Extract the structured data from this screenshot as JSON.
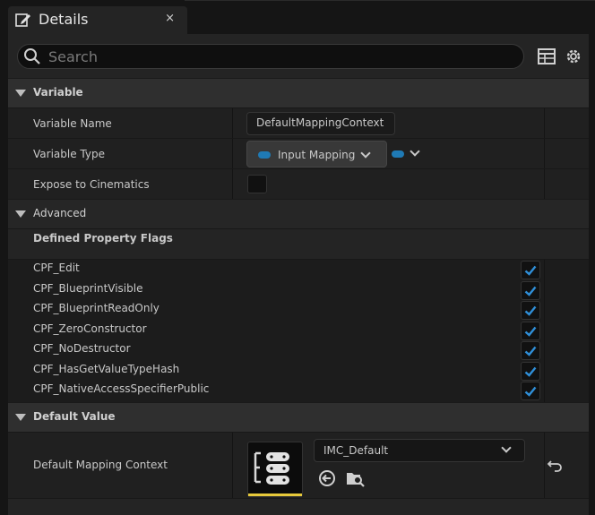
{
  "tab": {
    "title": "Details",
    "close_label": "×",
    "icon": "pencil-icon"
  },
  "search": {
    "placeholder": "Search",
    "value": ""
  },
  "toolbar": {
    "icons": [
      "table-view-icon",
      "gear-icon"
    ]
  },
  "variable": {
    "header": "Variable",
    "rows": {
      "name_label": "Variable Name",
      "name_value": "DefaultMappingContext",
      "type_label": "Variable Type",
      "type_value": "Input Mapping C",
      "cinematics_label": "Expose to Cinematics",
      "cinematics_checked": false
    }
  },
  "advanced": {
    "header": "Advanced",
    "flags_header": "Defined Property Flags",
    "flags": [
      {
        "label": "CPF_Edit",
        "checked": true
      },
      {
        "label": "CPF_BlueprintVisible",
        "checked": true
      },
      {
        "label": "CPF_BlueprintReadOnly",
        "checked": true
      },
      {
        "label": "CPF_ZeroConstructor",
        "checked": true
      },
      {
        "label": "CPF_NoDestructor",
        "checked": true
      },
      {
        "label": "CPF_HasGetValueTypeHash",
        "checked": true
      },
      {
        "label": "CPF_NativeAccessSpecifierPublic",
        "checked": true
      }
    ]
  },
  "default_value": {
    "header": "Default Value",
    "label": "Default Mapping Context",
    "asset": "IMC_Default",
    "icons": [
      "use-selected-arrow-icon",
      "browse-asset-icon",
      "reset-to-default-icon"
    ]
  },
  "colors": {
    "accent": "#1f7ab5",
    "check": "#2f8fd8",
    "thumb_underline": "#e7c93b"
  }
}
